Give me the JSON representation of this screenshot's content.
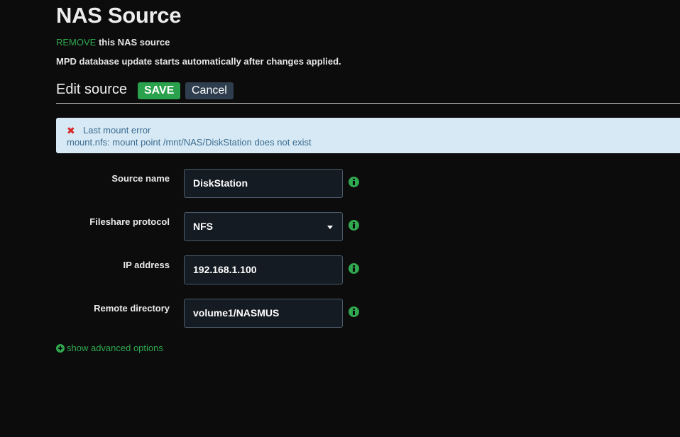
{
  "page": {
    "title": "NAS Source",
    "remove_link": "REMOVE",
    "remove_suffix": " this NAS source",
    "db_note": "MPD database update starts automatically after changes applied."
  },
  "edit": {
    "title": "Edit source",
    "save_label": "SAVE",
    "cancel_label": "Cancel"
  },
  "alert": {
    "icon": "close-icon",
    "title": "Last mount error",
    "message": "mount.nfs: mount point /mnt/NAS/DiskStation does not exist"
  },
  "form": {
    "source_name": {
      "label": "Source name",
      "value": "DiskStation",
      "icon": "info-icon"
    },
    "protocol": {
      "label": "Fileshare protocol",
      "value": "NFS",
      "icon": "info-icon"
    },
    "ip_address": {
      "label": "IP address",
      "value": "192.168.1.100",
      "icon": "info-icon"
    },
    "remote_dir": {
      "label": "Remote directory",
      "value": "volume1/NASMUS",
      "icon": "info-icon"
    }
  },
  "advanced": {
    "icon": "plus-circle-icon",
    "label": "show advanced options"
  },
  "colors": {
    "background": "#0c0c0c",
    "accent_green": "#2fa84f",
    "save_button": "#2aa14d",
    "cancel_button": "#2f3e4e",
    "alert_bg": "#d6e9f4",
    "alert_text": "#3c6c90",
    "error_red": "#d92727",
    "input_bg": "#151b22",
    "input_border": "#4b5b6a"
  }
}
